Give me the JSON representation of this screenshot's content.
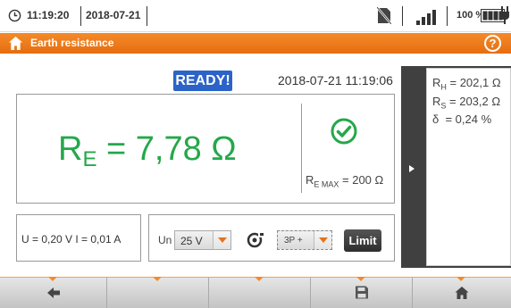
{
  "status_bar": {
    "time": "11:19:20",
    "date": "2018-07-21",
    "battery_percent": "100 %",
    "icons": [
      "clock-icon",
      "no-sd-card-icon",
      "signal-strength-icon",
      "battery-icon",
      "plug-icon"
    ]
  },
  "header": {
    "title": "Earth resistance",
    "help_label": "?",
    "accent_color": "#f07a1a"
  },
  "measurement": {
    "status": "READY!",
    "datetime": "2018-07-21 11:19:06",
    "result_symbol": "R",
    "result_subscript": "E",
    "result_value": " = 7,78 Ω",
    "result_color": "#24a84a",
    "remax_symbol": "R",
    "remax_subscript": "E MAX",
    "remax_value": " = 200 Ω",
    "voltage_current": "U = 0,20 V I = 0,01 A"
  },
  "side_results": {
    "rh_symbol": "R",
    "rh_subscript": "H",
    "rh_value": " = 202,1 Ω",
    "rs_symbol": "R",
    "rs_subscript": "S",
    "rs_value": " = 203,2 Ω",
    "delta_symbol": "δ",
    "delta_value": "  = 0,24 %"
  },
  "settings": {
    "un_label": "Un",
    "un_value": "25 V",
    "mode_value": "3P +",
    "limit_label": "Limit"
  },
  "toolbar": {
    "buttons": [
      "back-arrow-icon",
      "",
      "",
      "save-icon",
      "home-icon"
    ]
  }
}
